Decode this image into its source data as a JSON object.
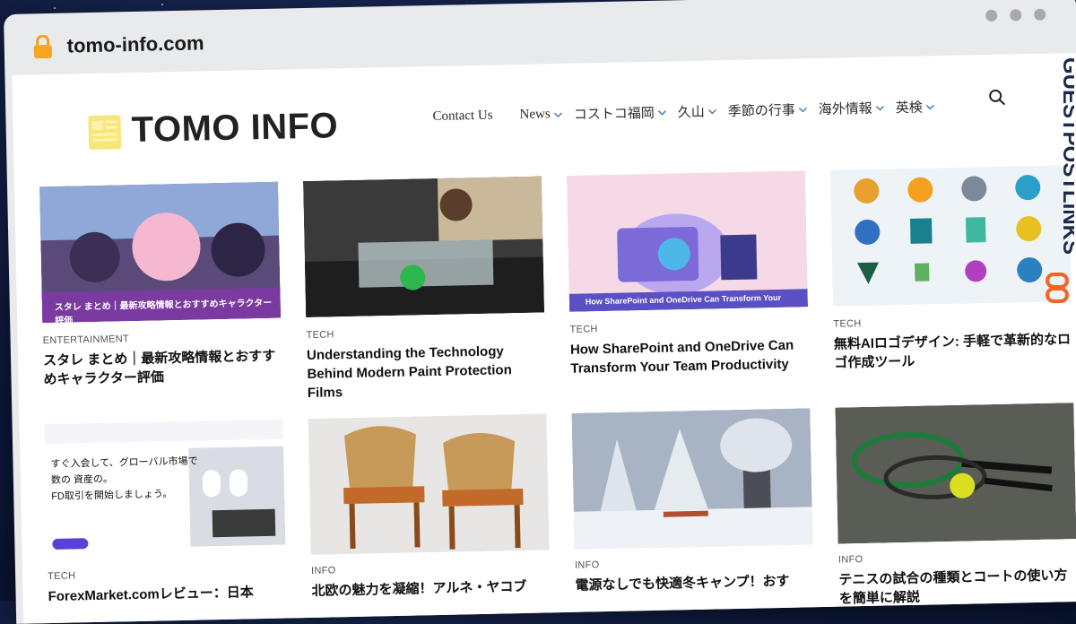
{
  "browser": {
    "url": "tomo-info.com",
    "lock_icon": "lock-icon"
  },
  "site": {
    "logo_text": "TOMO INFO",
    "logo_icon": "newspaper-icon"
  },
  "nav": {
    "items": [
      {
        "label": "Contact Us",
        "has_dropdown": false
      },
      {
        "label": "News",
        "has_dropdown": true
      },
      {
        "label": "コストコ福岡",
        "has_dropdown": true
      },
      {
        "label": "久山",
        "has_dropdown": true
      },
      {
        "label": "季節の行事",
        "has_dropdown": true
      },
      {
        "label": "海外情報",
        "has_dropdown": true
      },
      {
        "label": "英検",
        "has_dropdown": true
      }
    ],
    "search_icon": "search-icon"
  },
  "articles": [
    {
      "category": "ENTERTAINMENT",
      "title": "スタレ まとめ｜最新攻略情報とおすすめキャラクター評価",
      "thumb_caption": "スタレ まとめ｜最新攻略情報とおすすめキャラクター評価"
    },
    {
      "category": "TECH",
      "title": "Understanding the Technology Behind Modern Paint Protection Films"
    },
    {
      "category": "TECH",
      "title": "How SharePoint and OneDrive Can Transform Your Team Productivity",
      "thumb_caption": "How SharePoint and OneDrive Can Transform Your"
    },
    {
      "category": "TECH",
      "title": "無料AIロゴデザイン: 手軽で革新的なロゴ作成ツール"
    },
    {
      "category": "TECH",
      "title": "ForexMarket.comレビュー：日本",
      "thumb_lines": [
        "すぐ入会して、グローバル市場で",
        "数の 資産の。",
        "FD取引を開始しましょう。"
      ]
    },
    {
      "category": "INFO",
      "title": "北欧の魅力を凝縮！アルネ・ヤコブ"
    },
    {
      "category": "INFO",
      "title": "電源なしでも快適冬キャンプ！おす"
    },
    {
      "category": "INFO",
      "title": "テニスの試合の種類とコートの使い方を簡単に解説"
    }
  ],
  "side_brand": "GUESTPOSTLINKS",
  "colors": {
    "logo_accent": "#f7e77a",
    "brand_orange": "#f26522",
    "brand_navy": "#1d2a4d"
  }
}
